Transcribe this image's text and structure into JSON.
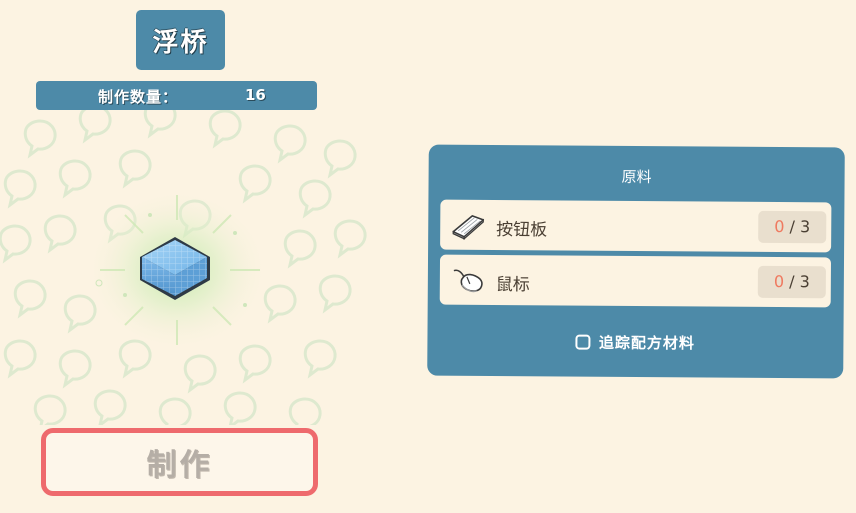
{
  "recipe": {
    "title": "浮桥",
    "quantity_label": "制作数量：",
    "quantity_value": "16",
    "item_icon": "blue-block-icon"
  },
  "craft_button": {
    "label": "制作"
  },
  "materials": {
    "title": "原料",
    "items": [
      {
        "name": "按钮板",
        "have": "0",
        "separator": " / ",
        "need": "3",
        "icon": "button-board-icon"
      },
      {
        "name": "鼠标",
        "have": "0",
        "separator": " / ",
        "need": "3",
        "icon": "mouse-icon"
      }
    ],
    "track_label": "追踪配方材料",
    "track_checked": false
  },
  "colors": {
    "background": "#fcf3e2",
    "panel_blue": "#4d8aa8",
    "button_border": "#ee6a6d",
    "count_have": "#ef7a60",
    "item_blue": "#8fc6f0"
  }
}
